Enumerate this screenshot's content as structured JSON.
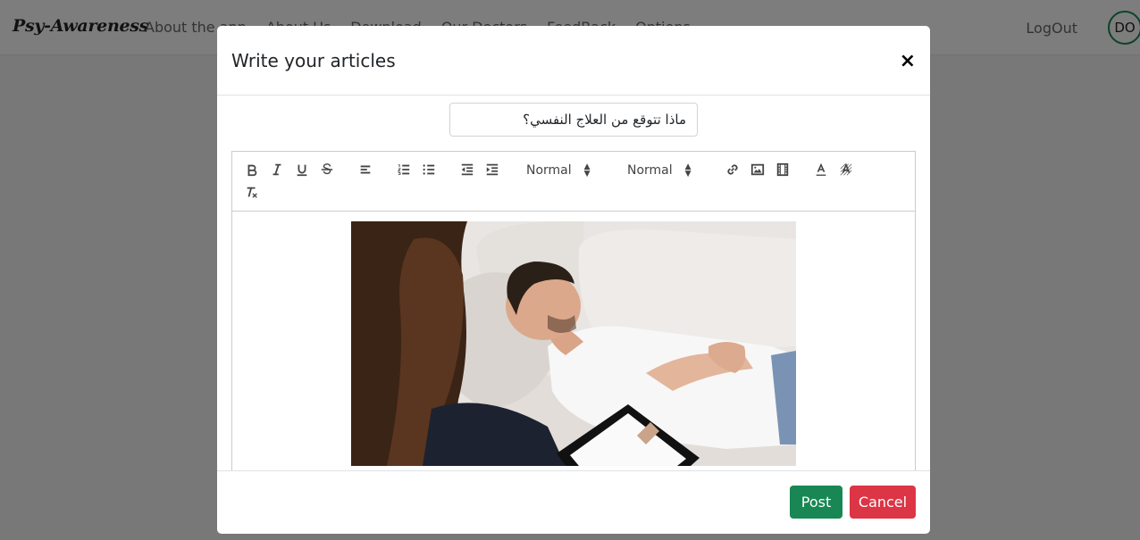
{
  "navbar": {
    "brand": "Psy-Awareness",
    "links": [
      "About the app",
      "About Us",
      "Download",
      "Our Doctors",
      "FeedBack",
      "Options"
    ],
    "logout": "LogOut",
    "avatar_initials": "DO"
  },
  "modal": {
    "title": "Write your articles",
    "close_symbol": "×",
    "article_title_value": "ماذا تتوقع من العلاج النفسي؟",
    "editor": {
      "header_picker": "Normal",
      "size_picker": "Normal"
    },
    "post_label": "Post",
    "cancel_label": "Cancel"
  },
  "colors": {
    "post": "#198754",
    "cancel": "#dc3545",
    "avatar_border": "#198754"
  }
}
